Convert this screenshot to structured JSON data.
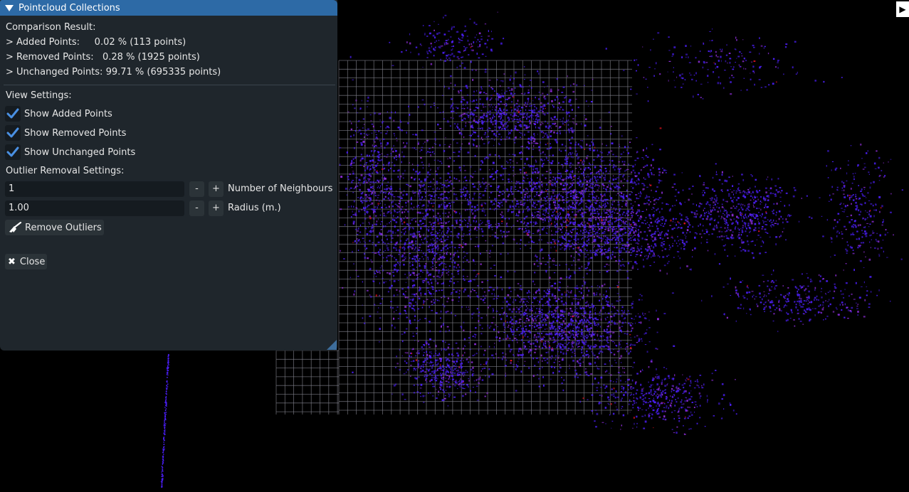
{
  "panel": {
    "title": "Pointcloud Collections",
    "comparison_heading": "Comparison Result:",
    "added_line": "> Added Points:     0.02 % (113 points)",
    "removed_line": "> Removed Points:   0.28 % (1925 points)",
    "unchanged_line": "> Unchanged Points: 99.71 % (695335 points)",
    "view_heading": "View Settings:",
    "view_options": [
      {
        "label": "Show Added Points",
        "checked": true
      },
      {
        "label": "Show Removed Points",
        "checked": true
      },
      {
        "label": "Show Unchanged Points",
        "checked": true
      }
    ],
    "outlier_heading": "Outlier Removal Settings:",
    "neighbours": {
      "value": "1",
      "label": "Number of Neighbours",
      "minus": "-",
      "plus": "+"
    },
    "radius": {
      "value": "1.00",
      "label": "Radius (m.)",
      "minus": "-",
      "plus": "+"
    },
    "remove_outliers_label": "Remove Outliers",
    "close_label": "Close"
  },
  "viewport": {
    "background": "#000000",
    "grid_color": "#7c7c86",
    "unchanged_color": "#4a1ef2",
    "added_color": "#8b2dd4",
    "removed_color": "#d9121c"
  },
  "expand_icon": "play-icon"
}
